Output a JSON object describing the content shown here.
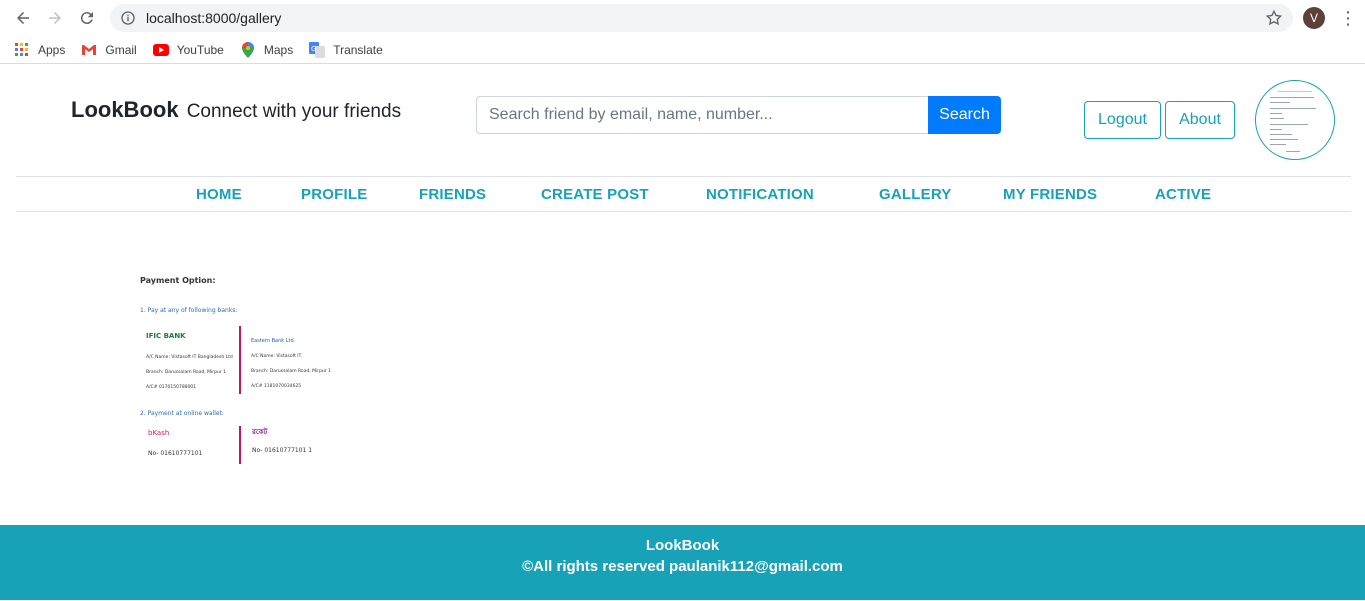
{
  "browser": {
    "url": "localhost:8000/gallery",
    "profile_initial": "V",
    "bookmarks": [
      {
        "label": "Apps",
        "icon": "apps-grid-icon"
      },
      {
        "label": "Gmail",
        "icon": "gmail-icon"
      },
      {
        "label": "YouTube",
        "icon": "youtube-icon"
      },
      {
        "label": "Maps",
        "icon": "maps-icon"
      },
      {
        "label": "Translate",
        "icon": "translate-icon"
      }
    ]
  },
  "header": {
    "brand": "LookBook",
    "tagline": "Connect with your friends",
    "search_placeholder": "Search friend by email, name, number...",
    "search_label": "Search",
    "logout_label": "Logout",
    "about_label": "About"
  },
  "nav": {
    "items": [
      "HOME",
      "PROFILE",
      "FRIENDS",
      "CREATE POST",
      "NOTIFICATION",
      "GALLERY",
      "MY FRIENDS",
      "ACTIVE"
    ]
  },
  "gallery": {
    "title": "Payment Option:",
    "section1": "1. Pay at any of following banks:",
    "section2": "2. Payment at online wallet:",
    "bank1_logo": "IFIC BANK",
    "bank1_lines": [
      "A/C Name: Vistasoft IT Bangladesh Ltd",
      "Branch: Darussalam Road, Mirpur 1",
      "A/C# 0170150788001"
    ],
    "bank2_logo": "Eastern Bank Ltd.",
    "bank2_lines": [
      "A/C Name: Vistasoft IT.",
      "Branch: Darussalam Road, Mirpur 1",
      "A/C# 1181070034625"
    ],
    "wallet1_logo": "bKash",
    "wallet1_no": "No- 01610777101",
    "wallet2_logo": "রকেট",
    "wallet2_no": "No- 01610777101 1"
  },
  "footer": {
    "brand": "LookBook",
    "copyright": "©All rights reserved paulanik112@gmail.com"
  },
  "colors": {
    "accent": "#17a2b8",
    "primary": "#007bff"
  }
}
